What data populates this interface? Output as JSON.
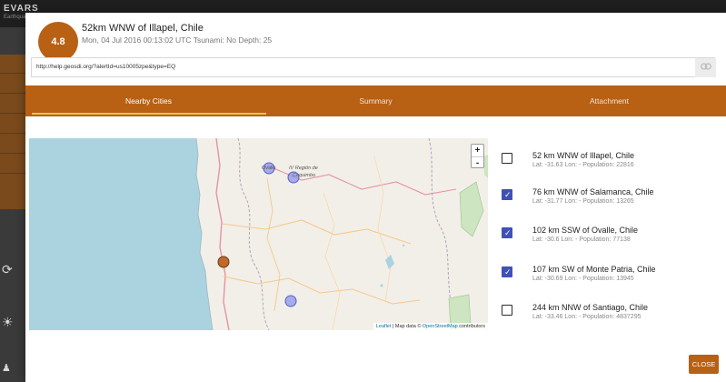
{
  "background": {
    "brand": "EVARS",
    "brand_sub": "Earthquake"
  },
  "event": {
    "magnitude": "4.8",
    "title": "52km WNW of Illapel, Chile",
    "meta": "Mon, 04 Jul 2016 00:13:02 UTC   Tsunami: No   Depth: 25"
  },
  "url": {
    "value": "http://help.geosdi.org/?alertId=us10005zpe&type=EQ",
    "link_icon": "link-icon"
  },
  "tabs": [
    {
      "label": "Nearby Cities",
      "active": true
    },
    {
      "label": "Summary",
      "active": false
    },
    {
      "label": "Attachment",
      "active": false
    }
  ],
  "map": {
    "zoom_in": "+",
    "zoom_out": "-",
    "attribution_leaflet": "Leaflet",
    "attribution_middle": " | Map data © ",
    "attribution_osm": "OpenStreetMap",
    "attribution_end": " contributors",
    "labels": {
      "ovalle": "Ovalle",
      "region_line1": "IV Región de",
      "region_line2": "Coquimbo"
    },
    "colors": {
      "sea": "#aad3df",
      "land": "#f2efe9",
      "city_marker": "#8c94e8",
      "quake_marker": "#c0692a"
    }
  },
  "cities": [
    {
      "name": "52 km WNW of Illapel, Chile",
      "info": "Lat: -31.63 Lon: - Population: 22816",
      "checked": false
    },
    {
      "name": "76 km WNW of Salamanca, Chile",
      "info": "Lat: -31.77 Lon: - Population: 13265",
      "checked": true
    },
    {
      "name": "102 km SSW of Ovalle, Chile",
      "info": "Lat: -30.6 Lon: - Population: 77138",
      "checked": true
    },
    {
      "name": "107 km SW of Monte Patria, Chile",
      "info": "Lat: -30.69 Lon: - Population: 13945",
      "checked": true
    },
    {
      "name": "244 km NNW of Santiago, Chile",
      "info": "Lat: -33.46 Lon: - Population: 4837295",
      "checked": false
    }
  ],
  "close_label": "CLOSE",
  "colors": {
    "accent": "#b86014",
    "tab_indicator": "#f3c24a",
    "checkbox": "#3f51b5"
  }
}
